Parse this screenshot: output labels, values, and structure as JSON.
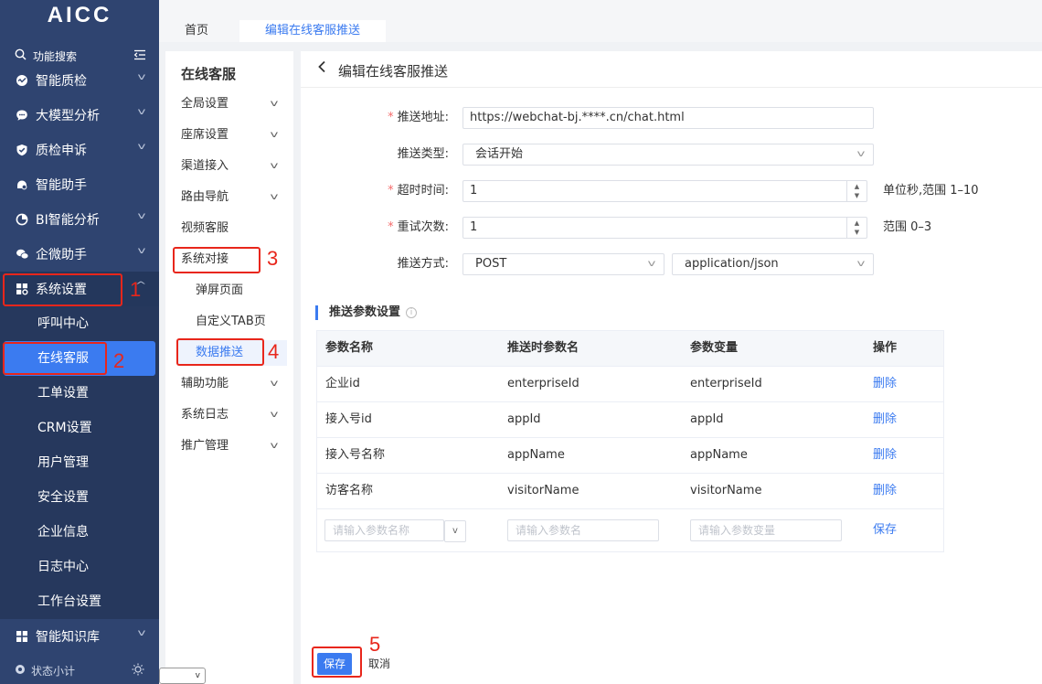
{
  "app": {
    "logo": "AICC"
  },
  "sidebar": {
    "search_label": "功能搜索",
    "items": [
      {
        "label": "智能质检",
        "icon": "quality-check-icon"
      },
      {
        "label": "大模型分析",
        "icon": "chat-bubble-icon"
      },
      {
        "label": "质检申诉",
        "icon": "shield-check-icon"
      },
      {
        "label": "智能助手",
        "icon": "assistant-icon"
      },
      {
        "label": "BI智能分析",
        "icon": "pie-chart-icon"
      },
      {
        "label": "企微助手",
        "icon": "wechat-icon"
      },
      {
        "label": "系统设置",
        "icon": "grid-settings-icon"
      },
      {
        "label": "智能知识库",
        "icon": "grid-icon"
      }
    ],
    "system_children": [
      "呼叫中心",
      "在线客服",
      "工单设置",
      "CRM设置",
      "用户管理",
      "安全设置",
      "企业信息",
      "日志中心",
      "工作台设置"
    ],
    "bottom_label": "状态小计"
  },
  "tabs": [
    {
      "label": "首页"
    },
    {
      "label": "编辑在线客服推送"
    }
  ],
  "submenu": {
    "title": "在线客服",
    "items": [
      "全局设置",
      "座席设置",
      "渠道接入",
      "路由导航",
      "视频客服",
      "系统对接",
      "弹屏页面",
      "自定义TAB页",
      "数据推送",
      "辅助功能",
      "系统日志",
      "推广管理"
    ]
  },
  "page": {
    "title": "编辑在线客服推送",
    "form": {
      "url_label": "推送地址:",
      "url_value": "https://webchat-bj.****.cn/chat.html",
      "type_label": "推送类型:",
      "type_value": "会话开始",
      "timeout_label": "超时时间:",
      "timeout_value": "1",
      "timeout_hint": "单位秒,范围 1–10",
      "retry_label": "重试次数:",
      "retry_value": "1",
      "retry_hint": "范围 0–3",
      "method_label": "推送方式:",
      "method_value": "POST",
      "content_type_value": "application/json"
    },
    "params": {
      "section_title": "推送参数设置",
      "columns": [
        "参数名称",
        "推送时参数名",
        "参数变量",
        "操作"
      ],
      "rows": [
        {
          "name": "企业id",
          "push_name": "enterpriseId",
          "variable": "enterpriseId",
          "action": "删除"
        },
        {
          "name": "接入号id",
          "push_name": "appId",
          "variable": "appId",
          "action": "删除"
        },
        {
          "name": "接入号名称",
          "push_name": "appName",
          "variable": "appName",
          "action": "删除"
        },
        {
          "name": "访客名称",
          "push_name": "visitorName",
          "variable": "visitorName",
          "action": "删除"
        }
      ],
      "new_row": {
        "name_placeholder": "请输入参数名称",
        "push_name_placeholder": "请输入参数名",
        "variable_placeholder": "请输入参数变量",
        "save_label": "保存"
      }
    },
    "footer": {
      "save_label": "保存",
      "cancel_label": "取消"
    }
  },
  "annotations": [
    "1",
    "2",
    "3",
    "4",
    "5"
  ],
  "colors": {
    "sidebar": "#2f4470",
    "accent": "#3b7bf0",
    "highlight": "#e8261b",
    "required": "#f56c6c"
  }
}
